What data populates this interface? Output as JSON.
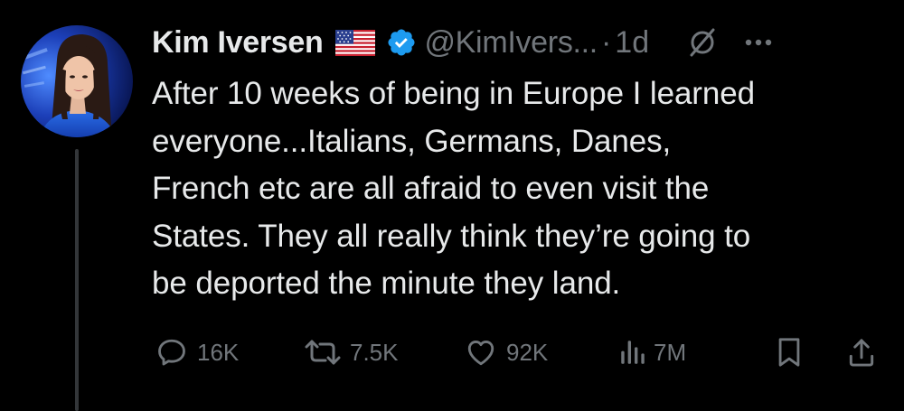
{
  "tweet": {
    "author": {
      "display_name": "Kim Iversen",
      "flag": "🇺🇸",
      "verified": true,
      "handle": "@KimIvers...",
      "avatar": "avatar-photo"
    },
    "separator": "·",
    "time": "1d",
    "text": "After 10 weeks of being in Europe I learned\neveryone...Italians, Germans, Danes,\nFrench etc are all afraid to even visit the\nStates. They all really think they’re going to\nbe deported the minute they land.",
    "actions": {
      "replies": "16K",
      "reposts": "7.5K",
      "likes": "92K",
      "views": "7M"
    }
  },
  "icons": {
    "verified": "verified-badge-icon",
    "grok": "grok-icon",
    "more": "more-icon",
    "reply": "reply-icon",
    "repost": "repost-icon",
    "like": "heart-icon",
    "views": "views-icon",
    "bookmark": "bookmark-icon",
    "share": "share-icon"
  },
  "colors": {
    "background": "#000000",
    "primary_text": "#e7e9ea",
    "secondary_text": "#71767b",
    "verified_blue": "#1d9bf0",
    "thread_line": "#333639"
  }
}
